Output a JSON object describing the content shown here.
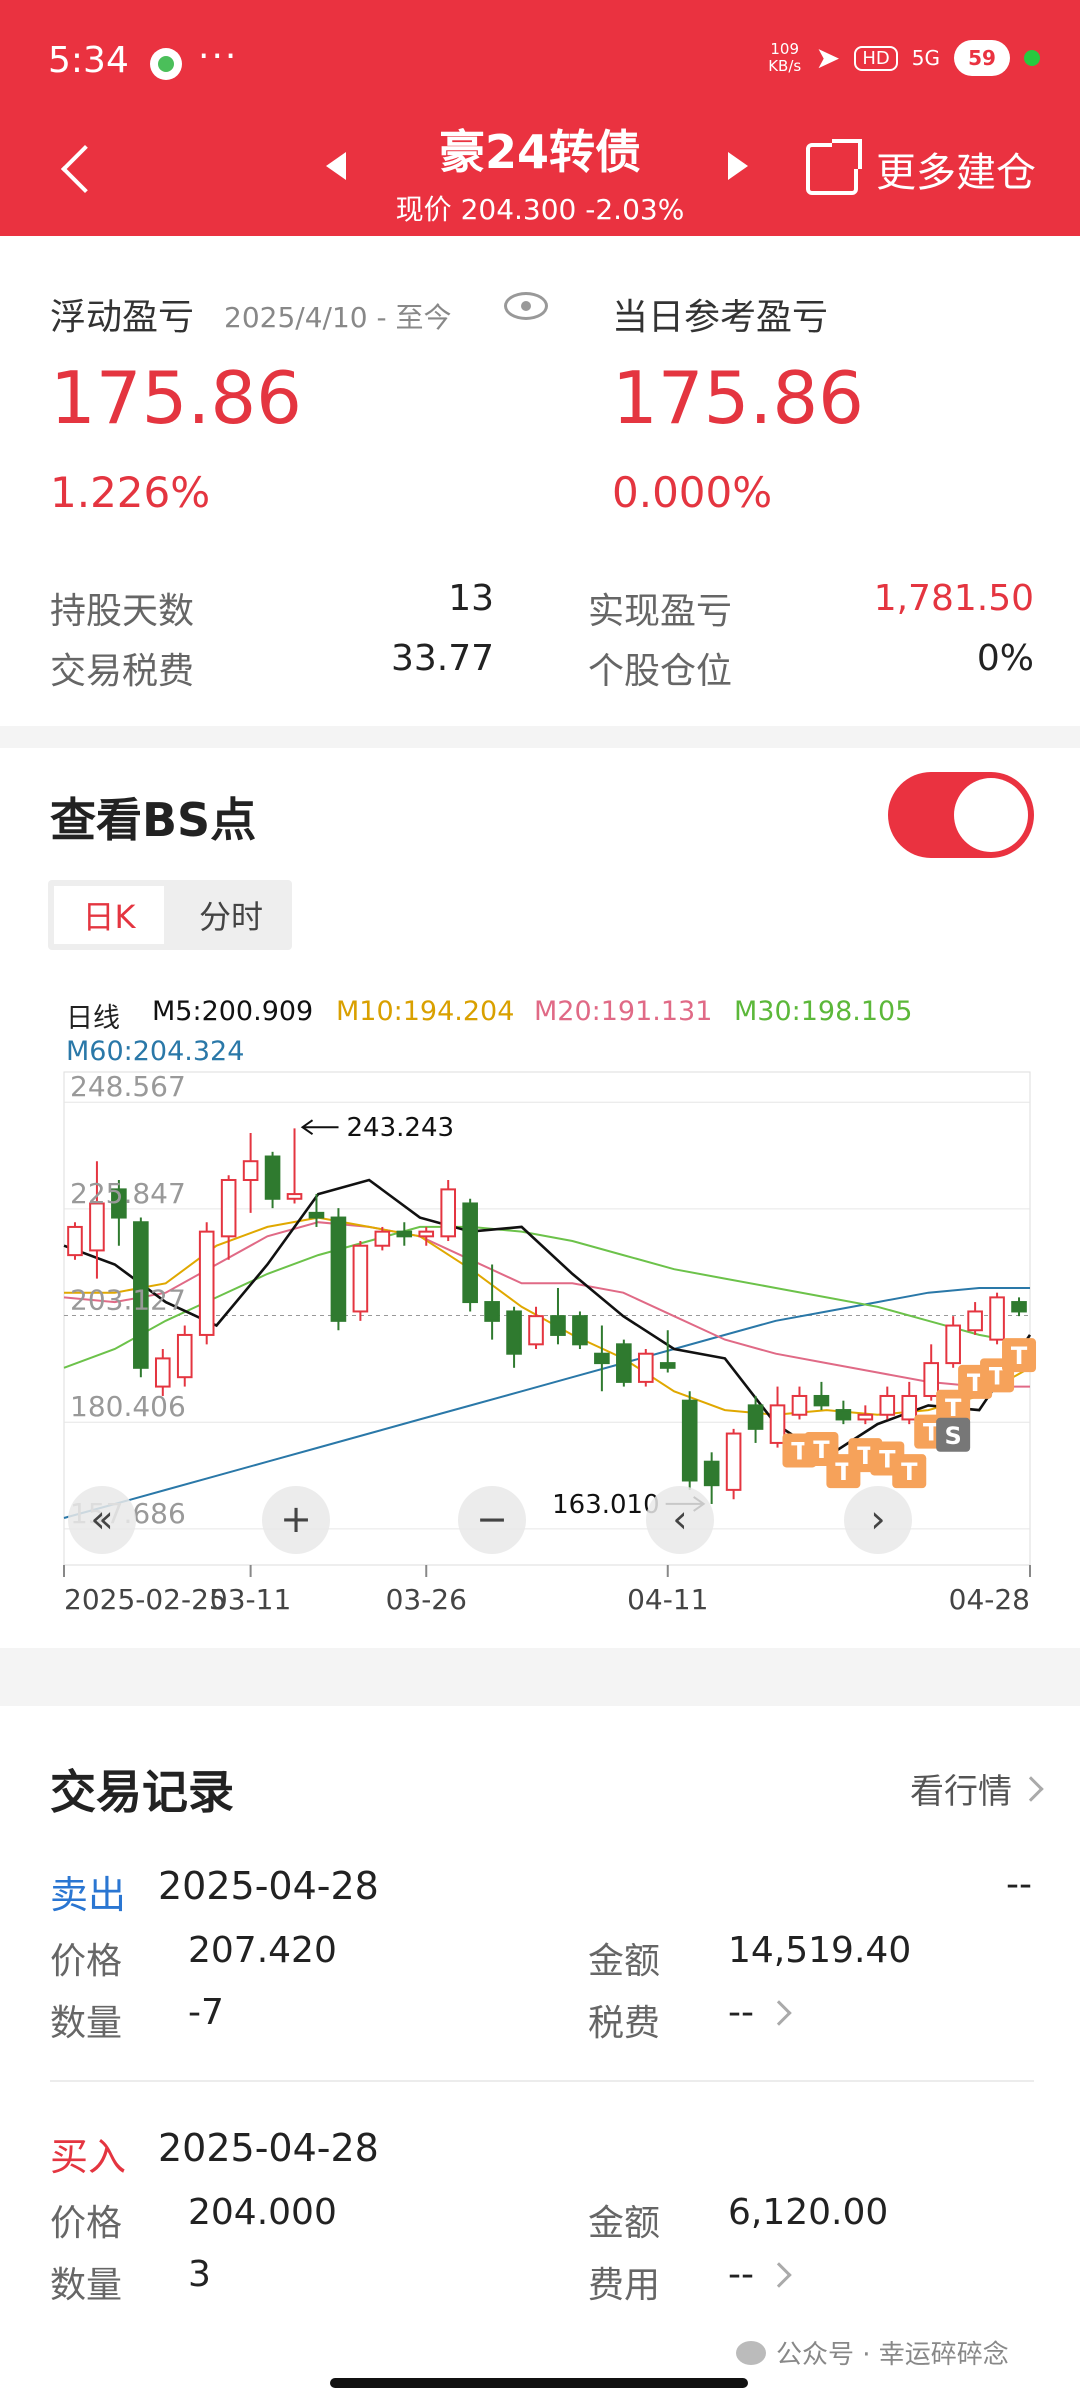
{
  "status_bar": {
    "time": "5:34",
    "more": "···",
    "net_speed_value": "109",
    "net_speed_unit": "KB/s",
    "hd": "HD",
    "signal": "5G",
    "battery": "59"
  },
  "header": {
    "title": "豪24转债",
    "subtitle": "现价 204.300 -2.03%",
    "more_button": "更多建仓"
  },
  "summary": {
    "floating_label": "浮动盈亏",
    "floating_period": "2025/4/10 - 至今",
    "floating_value": "175.86",
    "floating_pct": "1.226%",
    "today_label": "当日参考盈亏",
    "today_value": "175.86",
    "today_pct": "0.000%",
    "rows": [
      {
        "label": "持股天数",
        "value": "13"
      },
      {
        "label": "交易税费",
        "value": "33.77"
      },
      {
        "label": "实现盈亏",
        "value": "1,781.50"
      },
      {
        "label": "个股仓位",
        "value": "0%"
      }
    ]
  },
  "bs_section": {
    "title": "查看BS点",
    "toggle_on": true,
    "tab_daily": "日K",
    "tab_intraday": "分时"
  },
  "ma": {
    "label": "日线",
    "m5": "M5:200.909",
    "m10": "M10:194.204",
    "m20": "M20:191.131",
    "m30": "M30:198.105",
    "m60": "M60:204.324",
    "colors": {
      "m5": "#111111",
      "m10": "#e0a800",
      "m20": "#e06a86",
      "m30": "#6cc24a",
      "m60": "#2a78a8"
    }
  },
  "chart_data": {
    "type": "candlestick",
    "y_ticks": [
      "248.567",
      "225.847",
      "203.127",
      "180.406",
      "157.686"
    ],
    "ylim": [
      150.0,
      255.0
    ],
    "x_ticks": [
      "2025-02-25",
      "03-11",
      "03-26",
      "04-11",
      "04-28"
    ],
    "max_marker": "243.243",
    "min_marker": "163.010",
    "grid": true,
    "up_color": "#e43540",
    "down_color": "#2f7a2f",
    "candles": [
      {
        "o": 216,
        "c": 222,
        "h": 223,
        "l": 215
      },
      {
        "o": 217,
        "c": 227,
        "h": 236,
        "l": 211
      },
      {
        "o": 230,
        "c": 224,
        "h": 232,
        "l": 218
      },
      {
        "o": 223,
        "c": 192,
        "h": 224,
        "l": 190
      },
      {
        "o": 188,
        "c": 194,
        "h": 196,
        "l": 186
      },
      {
        "o": 190,
        "c": 199,
        "h": 201,
        "l": 188
      },
      {
        "o": 199,
        "c": 221,
        "h": 223,
        "l": 197
      },
      {
        "o": 220,
        "c": 232,
        "h": 233,
        "l": 215
      },
      {
        "o": 232,
        "c": 236,
        "h": 242,
        "l": 225
      },
      {
        "o": 237,
        "c": 228,
        "h": 238,
        "l": 226
      },
      {
        "o": 228,
        "c": 229,
        "h": 243,
        "l": 227
      },
      {
        "o": 225,
        "c": 224,
        "h": 229,
        "l": 222
      },
      {
        "o": 224,
        "c": 202,
        "h": 226,
        "l": 200
      },
      {
        "o": 204,
        "c": 218,
        "h": 219,
        "l": 202
      },
      {
        "o": 218,
        "c": 221,
        "h": 222,
        "l": 217
      },
      {
        "o": 221,
        "c": 220,
        "h": 223,
        "l": 218
      },
      {
        "o": 220,
        "c": 221,
        "h": 222,
        "l": 218
      },
      {
        "o": 220,
        "c": 230,
        "h": 232,
        "l": 219
      },
      {
        "o": 227,
        "c": 206,
        "h": 228,
        "l": 204
      },
      {
        "o": 206,
        "c": 202,
        "h": 214,
        "l": 198
      },
      {
        "o": 204,
        "c": 195,
        "h": 205,
        "l": 192
      },
      {
        "o": 197,
        "c": 203,
        "h": 205,
        "l": 196
      },
      {
        "o": 203,
        "c": 199,
        "h": 209,
        "l": 197
      },
      {
        "o": 203,
        "c": 197,
        "h": 204,
        "l": 196
      },
      {
        "o": 195,
        "c": 193,
        "h": 201,
        "l": 187
      },
      {
        "o": 197,
        "c": 189,
        "h": 198,
        "l": 188
      },
      {
        "o": 189,
        "c": 195,
        "h": 196,
        "l": 188
      },
      {
        "o": 193,
        "c": 192,
        "h": 200,
        "l": 191
      },
      {
        "o": 185,
        "c": 168,
        "h": 187,
        "l": 166
      },
      {
        "o": 172,
        "c": 167,
        "h": 174,
        "l": 163
      },
      {
        "o": 166,
        "c": 178,
        "h": 179,
        "l": 164
      },
      {
        "o": 184,
        "c": 179,
        "h": 186,
        "l": 176
      },
      {
        "o": 176,
        "c": 184,
        "h": 188,
        "l": 175
      },
      {
        "o": 182,
        "c": 186,
        "h": 188,
        "l": 181
      },
      {
        "o": 186,
        "c": 184,
        "h": 189,
        "l": 183
      },
      {
        "o": 183,
        "c": 181,
        "h": 185,
        "l": 180
      },
      {
        "o": 181,
        "c": 182,
        "h": 184,
        "l": 180
      },
      {
        "o": 182,
        "c": 186,
        "h": 188,
        "l": 181
      },
      {
        "o": 181,
        "c": 186,
        "h": 189,
        "l": 180
      },
      {
        "o": 186,
        "c": 193,
        "h": 197,
        "l": 185
      },
      {
        "o": 193,
        "c": 201,
        "h": 203,
        "l": 192
      },
      {
        "o": 200,
        "c": 204,
        "h": 206,
        "l": 199
      },
      {
        "o": 198,
        "c": 207,
        "h": 208,
        "l": 197
      },
      {
        "o": 206,
        "c": 204,
        "h": 207,
        "l": 203
      }
    ],
    "ma_series": [
      {
        "key": "m60",
        "values": [
          160,
          163,
          166,
          169,
          172,
          175,
          178,
          181,
          184,
          187,
          190,
          193,
          196,
          199,
          202,
          204,
          206,
          208,
          209,
          209
        ]
      },
      {
        "key": "m30",
        "values": [
          192,
          196,
          202,
          207,
          212,
          216,
          219,
          222,
          222,
          221,
          219,
          216,
          213,
          211,
          209,
          207,
          205,
          202,
          199,
          197
        ]
      },
      {
        "key": "m20",
        "values": [
          207,
          206,
          208,
          214,
          220,
          223,
          222,
          220,
          215,
          210,
          210,
          208,
          203,
          198,
          195,
          193,
          191,
          189,
          188,
          188
        ]
      },
      {
        "key": "m10",
        "values": [
          208,
          208,
          210,
          218,
          222,
          224,
          222,
          220,
          213,
          205,
          199,
          194,
          187,
          183,
          182,
          183,
          182,
          183,
          186,
          192
        ]
      },
      {
        "key": "m5",
        "values": [
          218,
          214,
          206,
          201,
          214,
          229,
          232,
          224,
          221,
          222,
          212,
          203,
          196,
          194,
          180,
          173,
          180,
          184,
          183,
          199
        ]
      }
    ],
    "bs_markers": [
      {
        "type": "T",
        "i": 33
      },
      {
        "type": "T",
        "i": 34
      },
      {
        "type": "T",
        "i": 35
      },
      {
        "type": "T",
        "i": 36
      },
      {
        "type": "T",
        "i": 37
      },
      {
        "type": "T",
        "i": 38
      },
      {
        "type": "T",
        "i": 39
      },
      {
        "type": "T",
        "i": 40
      },
      {
        "type": "T",
        "i": 41
      },
      {
        "type": "T",
        "i": 42
      },
      {
        "type": "T",
        "i": 43
      },
      {
        "type": "S",
        "i": 40
      }
    ],
    "nav_buttons": [
      "«",
      "+",
      "−",
      "‹",
      "›"
    ]
  },
  "trades": {
    "title": "交易记录",
    "market_link": "看行情",
    "records": [
      {
        "side": "卖出",
        "date": "2025-04-28",
        "price_label": "价格",
        "price": "207.420",
        "qty_label": "数量",
        "qty": "-7",
        "amount_label": "金额",
        "amount": "14,519.40",
        "fee_label": "税费",
        "fee": "--",
        "extra": "--"
      },
      {
        "side": "买入",
        "date": "2025-04-28",
        "price_label": "价格",
        "price": "204.000",
        "qty_label": "数量",
        "qty": "3",
        "amount_label": "金额",
        "amount": "6,120.00",
        "fee_label": "费用",
        "fee": "--"
      }
    ]
  },
  "watermark": "公众号 · 幸运碎碎念"
}
